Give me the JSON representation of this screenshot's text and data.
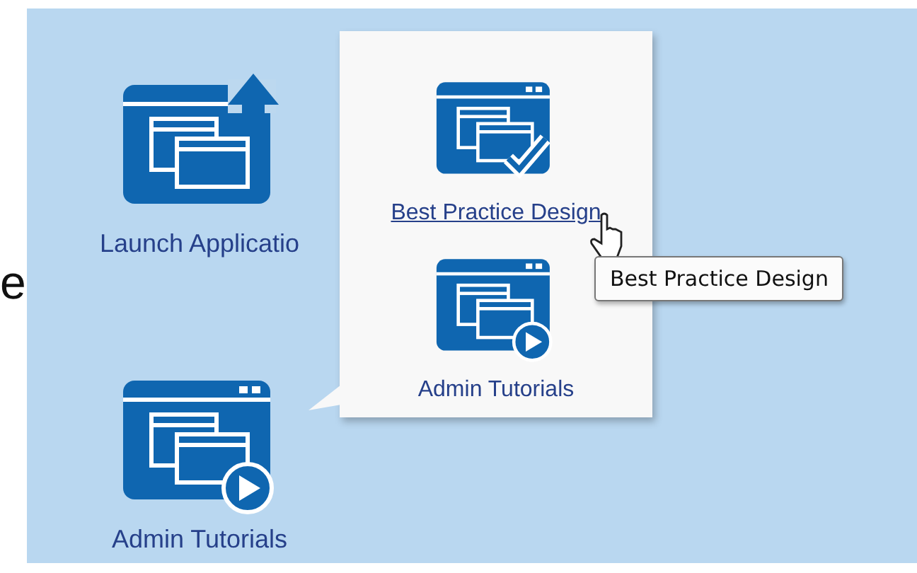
{
  "edge_text": "e",
  "desktop_items": [
    {
      "label": "Launch Applicatio",
      "kind": "launch"
    },
    {
      "label": "Admin Tutorials",
      "kind": "tutorial"
    }
  ],
  "popup": {
    "items": [
      {
        "label": "Best Practice Design",
        "kind": "check",
        "hovered": true
      },
      {
        "label": "Admin Tutorials",
        "kind": "tutorial",
        "hovered": false
      }
    ]
  },
  "tooltip": {
    "text": "Best Practice Design"
  }
}
